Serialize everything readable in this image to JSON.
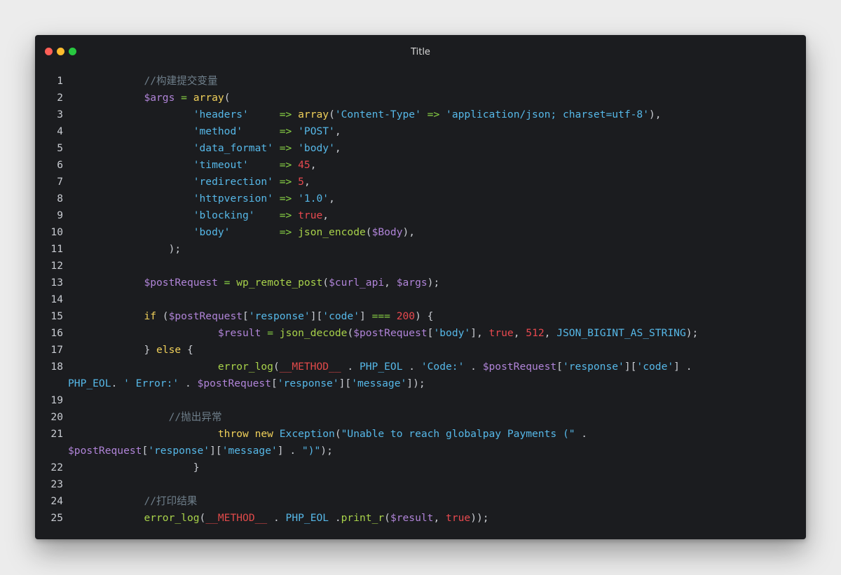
{
  "window": {
    "title": "Title"
  },
  "code_lines": [
    {
      "no": "1",
      "cont": null
    },
    {
      "no": "2",
      "cont": null
    },
    {
      "no": "3",
      "cont": null
    },
    {
      "no": "4",
      "cont": null
    },
    {
      "no": "5",
      "cont": null
    },
    {
      "no": "6",
      "cont": null
    },
    {
      "no": "7",
      "cont": null
    },
    {
      "no": "8",
      "cont": null
    },
    {
      "no": "9",
      "cont": null
    },
    {
      "no": "10",
      "cont": null
    },
    {
      "no": "11",
      "cont": null
    },
    {
      "no": "12",
      "cont": null
    },
    {
      "no": "13",
      "cont": null
    },
    {
      "no": "14",
      "cont": null
    },
    {
      "no": "15",
      "cont": null
    },
    {
      "no": "16",
      "cont": null
    },
    {
      "no": "17",
      "cont": null
    },
    {
      "no": "18",
      "cont": true
    },
    {
      "no": "19",
      "cont": null
    },
    {
      "no": "20",
      "cont": null
    },
    {
      "no": "21",
      "cont": true
    },
    {
      "no": "22",
      "cont": null
    },
    {
      "no": "23",
      "cont": null
    },
    {
      "no": "24",
      "cont": null
    },
    {
      "no": "25",
      "cont": null
    }
  ],
  "tokens": {
    "l1": [
      [
        "cm",
        "//构建提交变量"
      ]
    ],
    "l2": [
      [
        "var",
        "$args"
      ],
      [
        "pl",
        " "
      ],
      [
        "op",
        "="
      ],
      [
        "pl",
        " "
      ],
      [
        "kw",
        "array"
      ],
      [
        "pl",
        "("
      ]
    ],
    "l3": [
      [
        "str",
        "'headers'"
      ],
      [
        "pl",
        "     "
      ],
      [
        "op",
        "=>"
      ],
      [
        "pl",
        " "
      ],
      [
        "kw",
        "array"
      ],
      [
        "pl",
        "("
      ],
      [
        "str",
        "'Content-Type'"
      ],
      [
        "pl",
        " "
      ],
      [
        "op",
        "=>"
      ],
      [
        "pl",
        " "
      ],
      [
        "str",
        "'application/json; charset=utf-8'"
      ],
      [
        "pl",
        "),"
      ]
    ],
    "l4": [
      [
        "str",
        "'method'"
      ],
      [
        "pl",
        "      "
      ],
      [
        "op",
        "=>"
      ],
      [
        "pl",
        " "
      ],
      [
        "str",
        "'POST'"
      ],
      [
        "pl",
        ","
      ]
    ],
    "l5": [
      [
        "str",
        "'data_format'"
      ],
      [
        "pl",
        " "
      ],
      [
        "op",
        "=>"
      ],
      [
        "pl",
        " "
      ],
      [
        "str",
        "'body'"
      ],
      [
        "pl",
        ","
      ]
    ],
    "l6": [
      [
        "str",
        "'timeout'"
      ],
      [
        "pl",
        "     "
      ],
      [
        "op",
        "=>"
      ],
      [
        "pl",
        " "
      ],
      [
        "num",
        "45"
      ],
      [
        "pl",
        ","
      ]
    ],
    "l7": [
      [
        "str",
        "'redirection'"
      ],
      [
        "pl",
        " "
      ],
      [
        "op",
        "=>"
      ],
      [
        "pl",
        " "
      ],
      [
        "num",
        "5"
      ],
      [
        "pl",
        ","
      ]
    ],
    "l8": [
      [
        "str",
        "'httpversion'"
      ],
      [
        "pl",
        " "
      ],
      [
        "op",
        "=>"
      ],
      [
        "pl",
        " "
      ],
      [
        "str",
        "'1.0'"
      ],
      [
        "pl",
        ","
      ]
    ],
    "l9": [
      [
        "str",
        "'blocking'"
      ],
      [
        "pl",
        "    "
      ],
      [
        "op",
        "=>"
      ],
      [
        "pl",
        " "
      ],
      [
        "num",
        "true"
      ],
      [
        "pl",
        ","
      ]
    ],
    "l10": [
      [
        "str",
        "'body'"
      ],
      [
        "pl",
        "        "
      ],
      [
        "op",
        "=>"
      ],
      [
        "pl",
        " "
      ],
      [
        "fn",
        "json_encode"
      ],
      [
        "pl",
        "("
      ],
      [
        "var",
        "$Body"
      ],
      [
        "pl",
        "),"
      ]
    ],
    "l11": [
      [
        "pl",
        ");"
      ]
    ],
    "l12": [],
    "l13": [
      [
        "var",
        "$postRequest"
      ],
      [
        "pl",
        " "
      ],
      [
        "op",
        "="
      ],
      [
        "pl",
        " "
      ],
      [
        "fn",
        "wp_remote_post"
      ],
      [
        "pl",
        "("
      ],
      [
        "var",
        "$curl_api"
      ],
      [
        "pl",
        ", "
      ],
      [
        "var",
        "$args"
      ],
      [
        "pl",
        ");"
      ]
    ],
    "l14": [],
    "l15": [
      [
        "kw",
        "if"
      ],
      [
        "pl",
        " ("
      ],
      [
        "var",
        "$postRequest"
      ],
      [
        "pl",
        "["
      ],
      [
        "str",
        "'response'"
      ],
      [
        "pl",
        "]["
      ],
      [
        "str",
        "'code'"
      ],
      [
        "pl",
        "] "
      ],
      [
        "op",
        "==="
      ],
      [
        "pl",
        " "
      ],
      [
        "num",
        "200"
      ],
      [
        "pl",
        ") {"
      ]
    ],
    "l16": [
      [
        "var",
        "$result"
      ],
      [
        "pl",
        " "
      ],
      [
        "op",
        "="
      ],
      [
        "pl",
        " "
      ],
      [
        "fn",
        "json_decode"
      ],
      [
        "pl",
        "("
      ],
      [
        "var",
        "$postRequest"
      ],
      [
        "pl",
        "["
      ],
      [
        "str",
        "'body'"
      ],
      [
        "pl",
        "], "
      ],
      [
        "num",
        "true"
      ],
      [
        "pl",
        ", "
      ],
      [
        "num",
        "512"
      ],
      [
        "pl",
        ", "
      ],
      [
        "const",
        "JSON_BIGINT_AS_STRING"
      ],
      [
        "pl",
        ");"
      ]
    ],
    "l17": [
      [
        "pl",
        "} "
      ],
      [
        "kw",
        "else"
      ],
      [
        "pl",
        " {"
      ]
    ],
    "l18": [
      [
        "fn",
        "error_log"
      ],
      [
        "pl",
        "("
      ],
      [
        "mag",
        "__METHOD__"
      ],
      [
        "pl",
        " . "
      ],
      [
        "const",
        "PHP_EOL"
      ],
      [
        "pl",
        " . "
      ],
      [
        "str",
        "'Code:'"
      ],
      [
        "pl",
        " . "
      ],
      [
        "var",
        "$postRequest"
      ],
      [
        "pl",
        "["
      ],
      [
        "str",
        "'response'"
      ],
      [
        "pl",
        "]["
      ],
      [
        "str",
        "'code'"
      ],
      [
        "pl",
        "] ."
      ]
    ],
    "l18c": [
      [
        "const",
        "PHP_EOL"
      ],
      [
        "pl",
        ". "
      ],
      [
        "str",
        "' Error:'"
      ],
      [
        "pl",
        " . "
      ],
      [
        "var",
        "$postRequest"
      ],
      [
        "pl",
        "["
      ],
      [
        "str",
        "'response'"
      ],
      [
        "pl",
        "]["
      ],
      [
        "str",
        "'message'"
      ],
      [
        "pl",
        "]);"
      ]
    ],
    "l19": [],
    "l20": [
      [
        "cm",
        "//抛出异常"
      ]
    ],
    "l21": [
      [
        "kw",
        "throw"
      ],
      [
        "pl",
        " "
      ],
      [
        "kw",
        "new"
      ],
      [
        "pl",
        " "
      ],
      [
        "const",
        "Exception"
      ],
      [
        "pl",
        "("
      ],
      [
        "str",
        "\"Unable to reach globalpay Payments (\""
      ],
      [
        "pl",
        " ."
      ]
    ],
    "l21c": [
      [
        "var",
        "$postRequest"
      ],
      [
        "pl",
        "["
      ],
      [
        "str",
        "'response'"
      ],
      [
        "pl",
        "]["
      ],
      [
        "str",
        "'message'"
      ],
      [
        "pl",
        "] . "
      ],
      [
        "str",
        "\")\""
      ],
      [
        "pl",
        ");"
      ]
    ],
    "l22": [
      [
        "pl",
        "}"
      ]
    ],
    "l23": [],
    "l24": [
      [
        "cm",
        "//打印结果"
      ]
    ],
    "l25": [
      [
        "fn",
        "error_log"
      ],
      [
        "pl",
        "("
      ],
      [
        "mag",
        "__METHOD__"
      ],
      [
        "pl",
        " . "
      ],
      [
        "const",
        "PHP_EOL"
      ],
      [
        "pl",
        " ."
      ],
      [
        "fn",
        "print_r"
      ],
      [
        "pl",
        "("
      ],
      [
        "var",
        "$result"
      ],
      [
        "pl",
        ", "
      ],
      [
        "num",
        "true"
      ],
      [
        "pl",
        "));"
      ]
    ]
  },
  "indents": {
    "l1": 12,
    "l2": 12,
    "l3": 20,
    "l4": 20,
    "l5": 20,
    "l6": 20,
    "l7": 20,
    "l8": 20,
    "l9": 20,
    "l10": 20,
    "l11": 16,
    "l12": 0,
    "l13": 12,
    "l14": 0,
    "l15": 12,
    "l16": 24,
    "l17": 12,
    "l18": 24,
    "l19": 0,
    "l20": 16,
    "l21": 24,
    "l22": 20,
    "l23": 0,
    "l24": 12,
    "l25": 12
  }
}
